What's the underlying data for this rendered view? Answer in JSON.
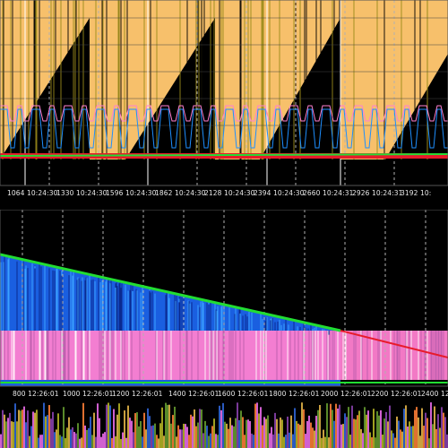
{
  "top_axis": {
    "ticks": [
      {
        "label": "1064 10:24:30"
      },
      {
        "label": "1330 10:24:30"
      },
      {
        "label": "1596 10:24:30"
      },
      {
        "label": "1862 10:24:30"
      },
      {
        "label": "2128 10:24:30"
      },
      {
        "label": "2394 10:24:30"
      },
      {
        "label": "2660 10:24:31"
      },
      {
        "label": "2926 10:24:31"
      },
      {
        "label": "3192 10:"
      }
    ]
  },
  "bottom_axis": {
    "ticks": [
      {
        "label": "800 12:26:01"
      },
      {
        "label": "1000 12:26:01"
      },
      {
        "label": "1200 12:26:01"
      },
      {
        "label": "1400 12:26:01"
      },
      {
        "label": "1600 12:26:01"
      },
      {
        "label": "1800 12:26:01"
      },
      {
        "label": "2000 12:26:01"
      },
      {
        "label": "2200 12:26:01"
      },
      {
        "label": "2400 12"
      }
    ]
  },
  "colors": {
    "background": "#000000",
    "area_orange": "#f7c06b",
    "line_green": "#22dd33",
    "line_red": "#e81a2a",
    "line_blue": "#1e8fff",
    "line_pink": "#ff7fd0",
    "trace_olive": "#9a8a1a",
    "grid_white": "#ffffff",
    "grid_dashed": "#b0b0b0"
  }
}
